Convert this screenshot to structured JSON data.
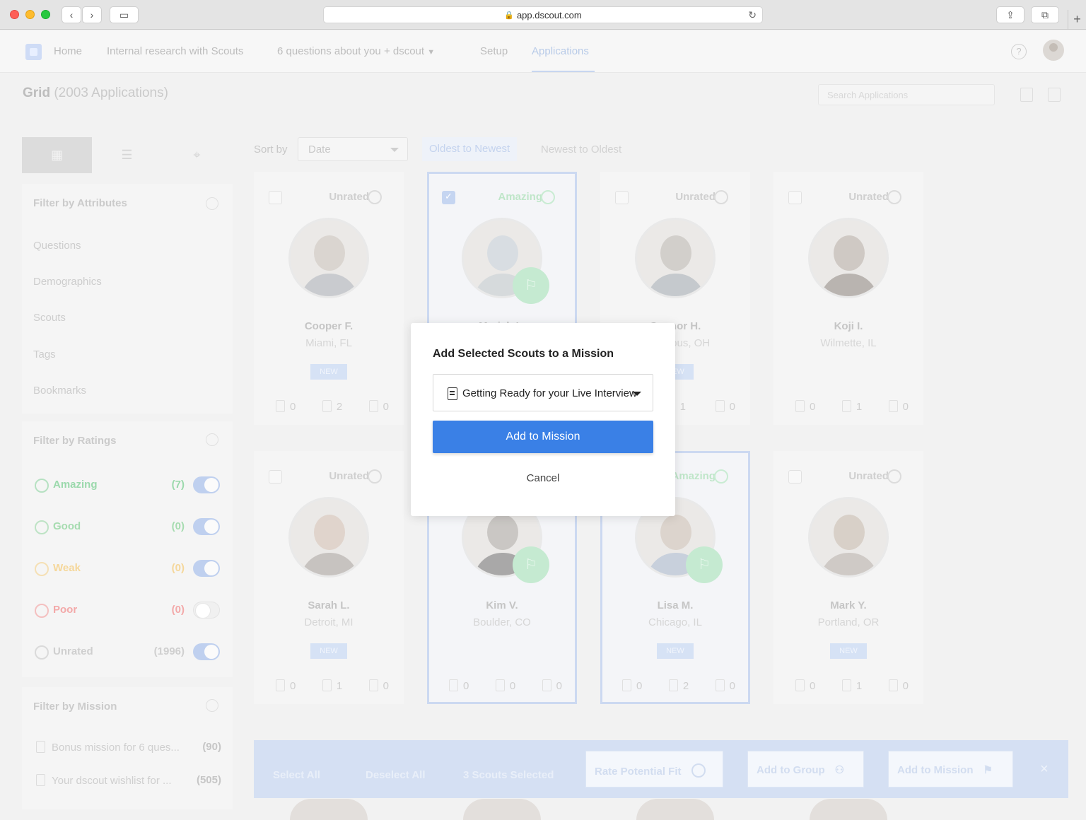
{
  "browser": {
    "url": "app.dscout.com"
  },
  "nav": {
    "home": "Home",
    "research": "Internal research with Scouts",
    "mission": "6 questions about you + dscout",
    "setup": "Setup",
    "applications": "Applications"
  },
  "header": {
    "title": "Grid",
    "count": "(2003 Applications)",
    "search_placeholder": "Search Applications"
  },
  "sidebar": {
    "attributes_title": "Filter by Attributes",
    "attributes": [
      "Questions",
      "Demographics",
      "Scouts",
      "Tags",
      "Bookmarks"
    ],
    "ratings_title": "Filter by Ratings",
    "ratings": [
      {
        "label": "Amazing",
        "count": "(7)",
        "color": "#9bd9ac",
        "on": true
      },
      {
        "label": "Good",
        "count": "(0)",
        "color": "#a6dcb0",
        "on": true
      },
      {
        "label": "Weak",
        "count": "(0)",
        "color": "#f5d79a",
        "on": true
      },
      {
        "label": "Poor",
        "count": "(0)",
        "color": "#f3a9a9",
        "on": false
      },
      {
        "label": "Unrated",
        "count": "(1996)",
        "color": "#cfcfcf",
        "on": true
      }
    ],
    "mission_title": "Filter by Mission",
    "missions": [
      {
        "label": "Bonus mission for 6 ques...",
        "count": "(90)"
      },
      {
        "label": "Your dscout wishlist for ...",
        "count": "(505)"
      }
    ]
  },
  "sort": {
    "label": "Sort by",
    "value": "Date",
    "opt1": "Oldest to Newest",
    "opt2": "Newest to Oldest"
  },
  "cards": [
    {
      "rating": "Unrated",
      "name": "Cooper F.",
      "loc": "Miami, FL",
      "new": "NEW",
      "s1": "0",
      "s2": "2",
      "s3": "0"
    },
    {
      "rating": "Amazing",
      "name": "Mariah L.",
      "loc": "",
      "new": "",
      "s1": "",
      "s2": "",
      "s3": ""
    },
    {
      "rating": "Unrated",
      "name": "Connor H.",
      "loc": "Columbus, OH",
      "new": "NEW",
      "s1": "",
      "s2": "1",
      "s3": "0"
    },
    {
      "rating": "Unrated",
      "name": "Koji I.",
      "loc": "Wilmette, IL",
      "new": "",
      "s1": "0",
      "s2": "1",
      "s3": "0"
    },
    {
      "rating": "Unrated",
      "name": "Sarah L.",
      "loc": "Detroit, MI",
      "new": "NEW",
      "s1": "0",
      "s2": "1",
      "s3": "0"
    },
    {
      "rating": "Amazing",
      "name": "Kim V.",
      "loc": "Boulder, CO",
      "new": "",
      "s1": "0",
      "s2": "0",
      "s3": "0"
    },
    {
      "rating": "Amazing",
      "name": "Lisa M.",
      "loc": "Chicago, IL",
      "new": "NEW",
      "s1": "0",
      "s2": "2",
      "s3": "0"
    },
    {
      "rating": "Unrated",
      "name": "Mark Y.",
      "loc": "Portland, OR",
      "new": "NEW",
      "s1": "0",
      "s2": "1",
      "s3": "0"
    }
  ],
  "actionbar": {
    "select_all": "Select All",
    "deselect_all": "Deselect All",
    "selected": "3 Scouts Selected",
    "rate": "Rate Potential Fit",
    "add_group": "Add to Group",
    "add_mission": "Add to Mission",
    "close": "×"
  },
  "modal": {
    "title": "Add Selected Scouts to a Mission",
    "select_value": "Getting Ready for your Live Interview",
    "primary": "Add to Mission",
    "cancel": "Cancel"
  }
}
